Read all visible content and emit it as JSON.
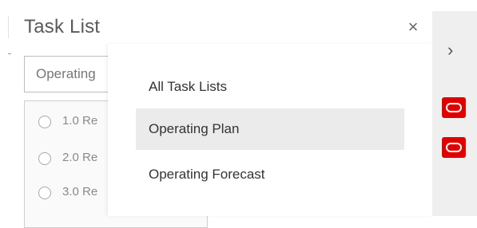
{
  "panel": {
    "title": "Task List",
    "close_glyph": "×",
    "search": {
      "value": "Operating"
    },
    "tasks": [
      {
        "label": "1.0 Re"
      },
      {
        "label": "2.0 Re"
      },
      {
        "label": "3.0 Re"
      }
    ]
  },
  "dropdown": {
    "items": [
      {
        "label": "All Task Lists",
        "selected": false
      },
      {
        "label": "Operating Plan",
        "selected": true
      },
      {
        "label": "Operating Forecast",
        "selected": false
      }
    ]
  },
  "side": {
    "chevron_glyph": "›",
    "icons": [
      "oracle-logo-icon",
      "oracle-logo-icon"
    ],
    "accent": "#e00000"
  }
}
